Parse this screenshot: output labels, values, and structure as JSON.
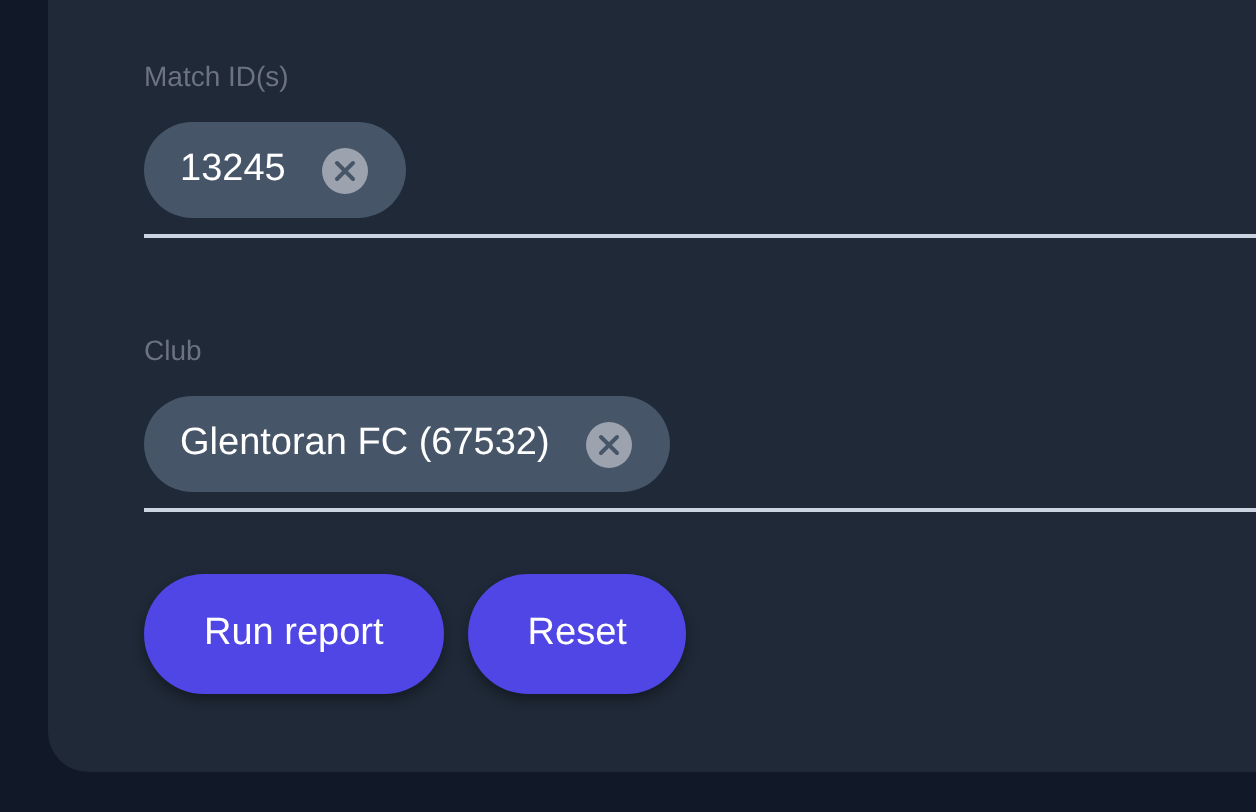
{
  "fields": [
    {
      "label": "Match ID(s)",
      "chips": [
        {
          "text": "13245"
        }
      ]
    },
    {
      "label": "Club",
      "chips": [
        {
          "text": "Glentoran FC (67532)"
        }
      ]
    }
  ],
  "buttons": [
    {
      "label": "Run report"
    },
    {
      "label": "Reset"
    }
  ]
}
